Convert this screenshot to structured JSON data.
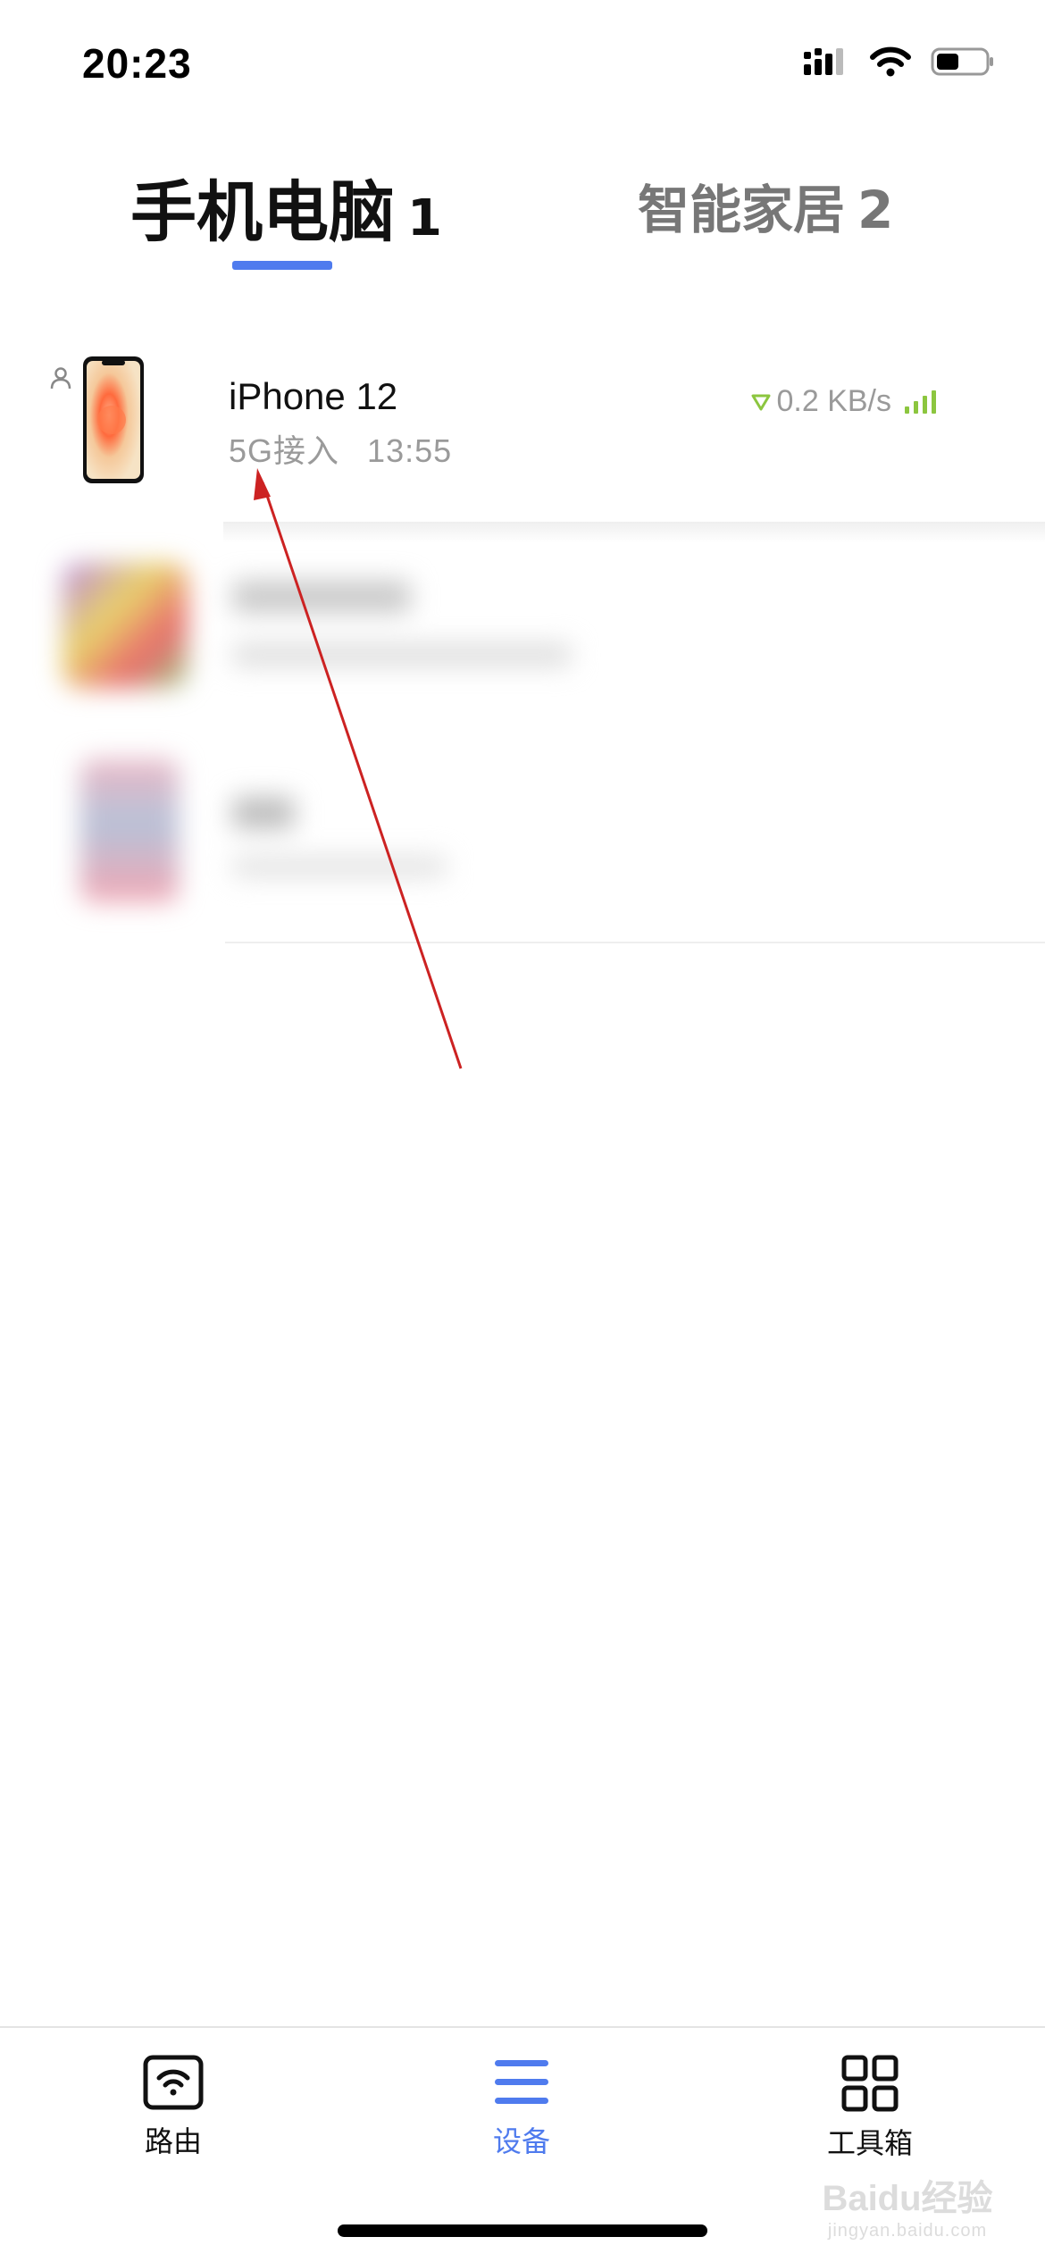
{
  "status_bar": {
    "time": "20:23"
  },
  "tabs": [
    {
      "label": "手机电脑",
      "count": "1"
    },
    {
      "label": "智能家居",
      "count": "2"
    }
  ],
  "device": {
    "name": "iPhone 12",
    "connection": "5G接入",
    "time": "13:55",
    "speed": "0.2 KB/s"
  },
  "bottom_nav": [
    {
      "label": "路由",
      "icon": "wifi-router-icon"
    },
    {
      "label": "设备",
      "icon": "menu-list-icon"
    },
    {
      "label": "工具箱",
      "icon": "grid-toolbox-icon"
    }
  ],
  "watermark": {
    "brand": "Baidu经验",
    "url": "jingyan.baidu.com"
  },
  "colors": {
    "accent": "#4f7bee",
    "signal_green": "#8cc63f",
    "annotation_arrow": "#cc2222"
  }
}
